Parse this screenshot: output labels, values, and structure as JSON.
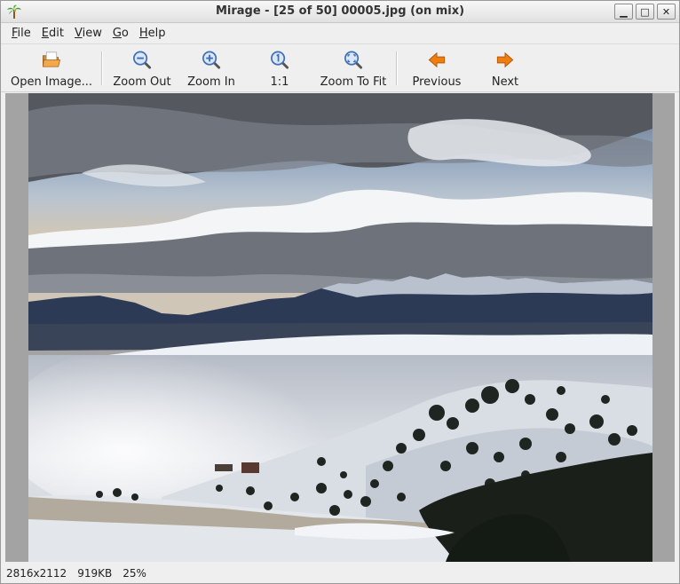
{
  "window": {
    "title": "Mirage - [25 of 50] 00005.jpg (on mix)",
    "minimize_glyph": "▁",
    "maximize_glyph": "□",
    "close_glyph": "✕"
  },
  "menu": [
    {
      "key": "F",
      "rest": "ile"
    },
    {
      "key": "E",
      "rest": "dit"
    },
    {
      "key": "V",
      "rest": "iew"
    },
    {
      "key": "G",
      "rest": "o"
    },
    {
      "key": "H",
      "rest": "elp"
    }
  ],
  "toolbar": {
    "open": "Open Image...",
    "zoom_out": "Zoom Out",
    "zoom_in": "Zoom In",
    "one_to_one": "1:1",
    "zoom_fit": "Zoom To Fit",
    "previous": "Previous",
    "next": "Next"
  },
  "icons": {
    "app": "palm-tree-icon",
    "open": "open-folder-icon",
    "zoom_out": "zoom-out-icon",
    "zoom_in": "zoom-in-icon",
    "one_to_one": "zoom-100-icon",
    "zoom_fit": "zoom-fit-icon",
    "previous": "arrow-left-icon",
    "next": "arrow-right-icon"
  },
  "colors": {
    "accent_orange": "#f07d10",
    "zoom_icon_blue": "#3f6fb5",
    "viewer_bg": "#a3a3a3"
  },
  "status": {
    "dimensions": "2816x2112",
    "file_size": "919KB",
    "zoom": "25%"
  }
}
